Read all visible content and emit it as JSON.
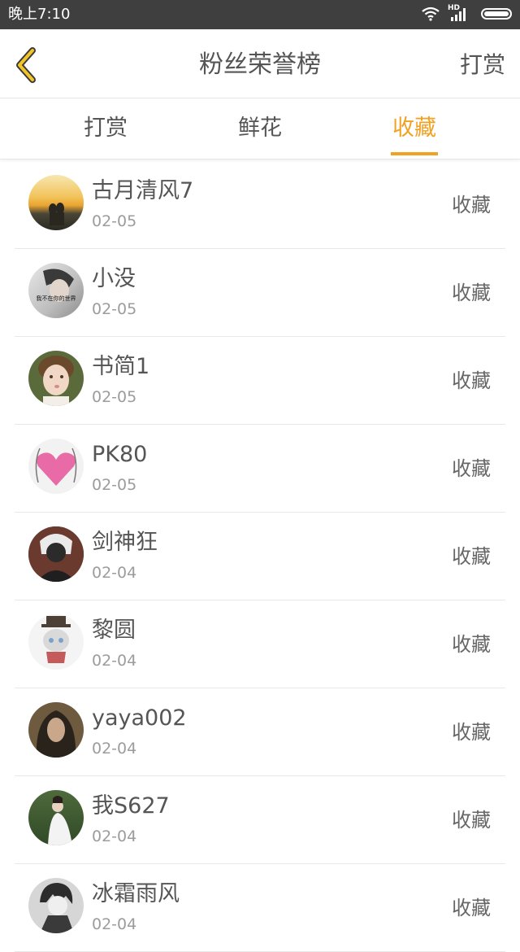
{
  "status_bar": {
    "time": "晚上7:10",
    "network": "HD"
  },
  "header": {
    "title": "粉丝荣誉榜",
    "right_action": "打赏"
  },
  "tabs": [
    {
      "label": "打赏",
      "active": false
    },
    {
      "label": "鲜花",
      "active": false
    },
    {
      "label": "收藏",
      "active": true
    }
  ],
  "accent_color": "#f0a223",
  "fans": [
    {
      "name": "古月清风7",
      "date": "02-05",
      "type": "收藏"
    },
    {
      "name": "小没",
      "date": "02-05",
      "type": "收藏",
      "avatar_text": "我不在你的世界"
    },
    {
      "name": "书简1",
      "date": "02-05",
      "type": "收藏"
    },
    {
      "name": "PK80",
      "date": "02-05",
      "type": "收藏"
    },
    {
      "name": "剑神狂",
      "date": "02-04",
      "type": "收藏"
    },
    {
      "name": "黎圆",
      "date": "02-04",
      "type": "收藏"
    },
    {
      "name": "yaya002",
      "date": "02-04",
      "type": "收藏"
    },
    {
      "name": "我S627",
      "date": "02-04",
      "type": "收藏"
    },
    {
      "name": "冰霜雨风",
      "date": "02-04",
      "type": "收藏"
    }
  ]
}
